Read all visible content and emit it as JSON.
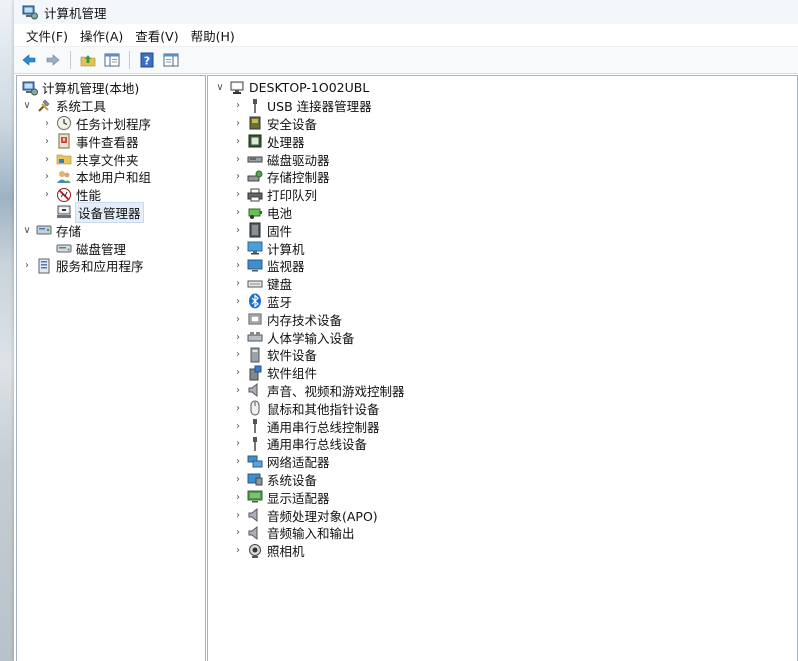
{
  "window": {
    "title": "计算机管理"
  },
  "menubar": {
    "items": [
      "文件(F)",
      "操作(A)",
      "查看(V)",
      "帮助(H)"
    ]
  },
  "toolbar": {
    "buttons": [
      "back-icon",
      "forward-icon",
      "up-folder-icon",
      "show-hide-tree-icon",
      "help-icon",
      "console-pane-icon"
    ]
  },
  "tree": {
    "root": "计算机管理(本地)",
    "system_tools": {
      "label": "系统工具",
      "children": [
        "任务计划程序",
        "事件查看器",
        "共享文件夹",
        "本地用户和组",
        "性能",
        "设备管理器"
      ]
    },
    "storage": {
      "label": "存储",
      "children": [
        "磁盘管理"
      ]
    },
    "services": {
      "label": "服务和应用程序"
    }
  },
  "devices": {
    "root": "DESKTOP-1O02UBL",
    "items": [
      "USB 连接器管理器",
      "安全设备",
      "处理器",
      "磁盘驱动器",
      "存储控制器",
      "打印队列",
      "电池",
      "固件",
      "计算机",
      "监视器",
      "键盘",
      "蓝牙",
      "内存技术设备",
      "人体学输入设备",
      "软件设备",
      "软件组件",
      "声音、视频和游戏控制器",
      "鼠标和其他指针设备",
      "通用串行总线控制器",
      "通用串行总线设备",
      "网络适配器",
      "系统设备",
      "显示适配器",
      "音频处理对象(APO)",
      "音频输入和输出",
      "照相机"
    ]
  }
}
